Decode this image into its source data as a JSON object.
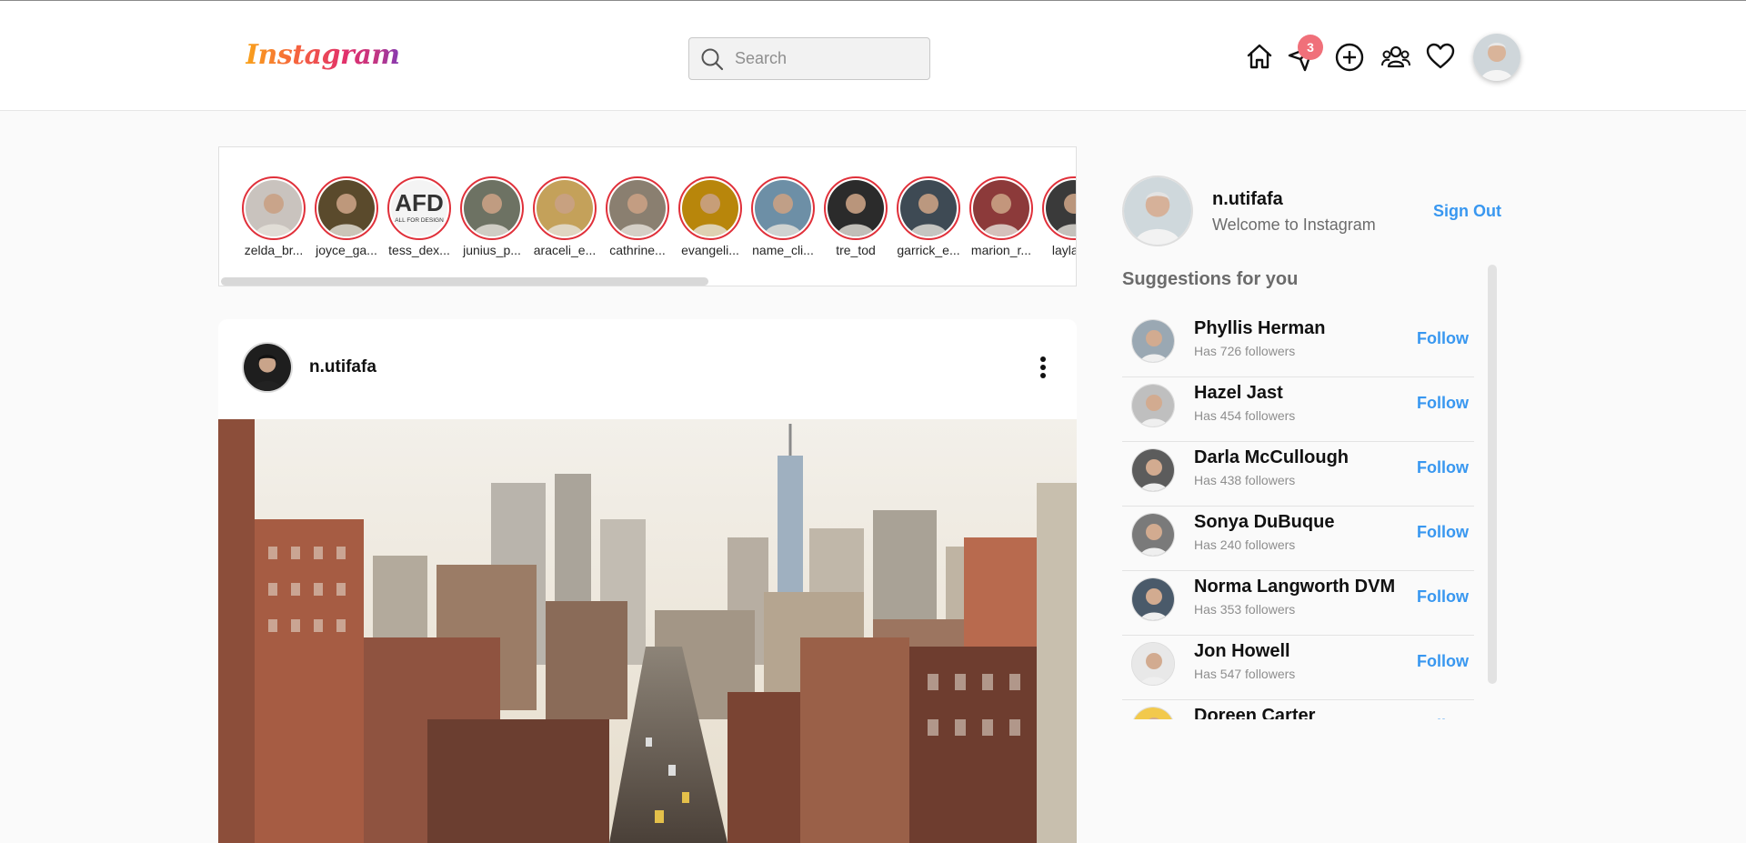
{
  "app": {
    "logo_text": "Instagram"
  },
  "header": {
    "search_placeholder": "Search",
    "notifications_count": "3",
    "icons": [
      "home-icon",
      "direct-message-icon",
      "add-post-icon",
      "people-icon",
      "heart-icon"
    ]
  },
  "stories": [
    {
      "name": "zelda_br...",
      "color": "#c9c3be"
    },
    {
      "name": "joyce_ga...",
      "color": "#5a4a2c"
    },
    {
      "name": "tess_dex...",
      "color": "#f3f3f3"
    },
    {
      "name": "junius_p...",
      "color": "#6d7263"
    },
    {
      "name": "araceli_e...",
      "color": "#c4a15a"
    },
    {
      "name": "cathrine...",
      "color": "#8a7f70"
    },
    {
      "name": "evangeli...",
      "color": "#b8860b"
    },
    {
      "name": "name_cli...",
      "color": "#6d8fa6"
    },
    {
      "name": "tre_tod",
      "color": "#2b2b2b"
    },
    {
      "name": "garrick_e...",
      "color": "#3e4a54"
    },
    {
      "name": "marion_r...",
      "color": "#8c3a3a"
    },
    {
      "name": "layla_...",
      "color": "#3a3a3a"
    }
  ],
  "story_badge_text": "AFD",
  "story_badge_sub": "ALL FOR DESIGN",
  "post": {
    "username": "n.utifafa"
  },
  "sidebar": {
    "username": "n.utifafa",
    "welcome": "Welcome to Instagram",
    "signout_label": "Sign Out",
    "suggestions_title": "Suggestions for you",
    "follow_label": "Follow",
    "suggestions": [
      {
        "name": "Phyllis Herman",
        "followers": "Has 726 followers"
      },
      {
        "name": "Hazel Jast",
        "followers": "Has 454 followers"
      },
      {
        "name": "Darla McCullough",
        "followers": "Has 438 followers"
      },
      {
        "name": "Sonya DuBuque",
        "followers": "Has 240 followers"
      },
      {
        "name": "Norma Langworth DVM",
        "followers": "Has 353 followers"
      },
      {
        "name": "Jon Howell",
        "followers": "Has 547 followers"
      },
      {
        "name": "Doreen Carter",
        "followers": ""
      }
    ]
  },
  "colors": {
    "accent": "#3897f0",
    "story_ring": "#e0303a",
    "badge": "#f0707a"
  }
}
